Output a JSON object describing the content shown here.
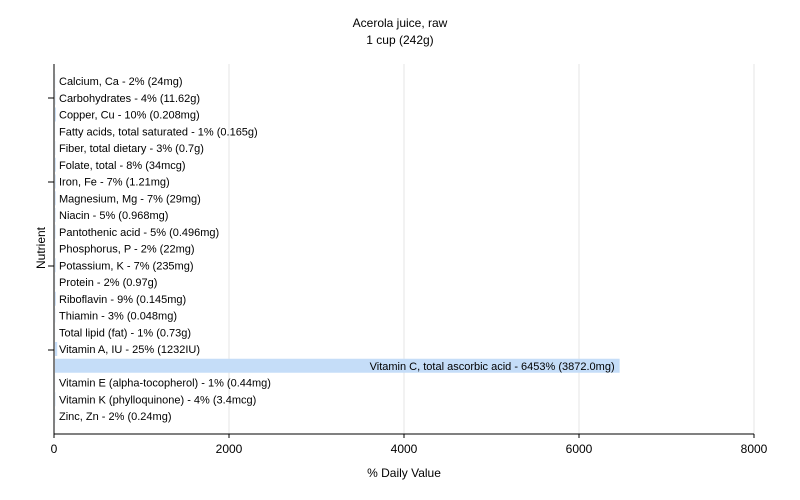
{
  "chart_data": {
    "type": "bar",
    "orientation": "horizontal",
    "title": "Acerola juice, raw",
    "subtitle": "1 cup (242g)",
    "xlabel": "% Daily Value",
    "ylabel": "Nutrient",
    "xlim": [
      0,
      8000
    ],
    "xticks": [
      0,
      2000,
      4000,
      6000,
      8000
    ],
    "grid": true,
    "bar_color": "#c5ddf8",
    "categories": [
      "Calcium, Ca",
      "Carbohydrates",
      "Copper, Cu",
      "Fatty acids, total saturated",
      "Fiber, total dietary",
      "Folate, total",
      "Iron, Fe",
      "Magnesium, Mg",
      "Niacin",
      "Pantothenic acid",
      "Phosphorus, P",
      "Potassium, K",
      "Protein",
      "Riboflavin",
      "Thiamin",
      "Total lipid (fat)",
      "Vitamin A, IU",
      "Vitamin C, total ascorbic acid",
      "Vitamin E (alpha-tocopherol)",
      "Vitamin K (phylloquinone)",
      "Zinc, Zn"
    ],
    "values": [
      2,
      4,
      10,
      1,
      3,
      8,
      7,
      7,
      5,
      5,
      2,
      7,
      2,
      9,
      3,
      1,
      25,
      6453,
      1,
      4,
      2
    ],
    "labels": [
      "Calcium, Ca - 2% (24mg)",
      "Carbohydrates - 4% (11.62g)",
      "Copper, Cu - 10% (0.208mg)",
      "Fatty acids, total saturated - 1% (0.165g)",
      "Fiber, total dietary - 3% (0.7g)",
      "Folate, total - 8% (34mcg)",
      "Iron, Fe - 7% (1.21mg)",
      "Magnesium, Mg - 7% (29mg)",
      "Niacin - 5% (0.968mg)",
      "Pantothenic acid - 5% (0.496mg)",
      "Phosphorus, P - 2% (22mg)",
      "Potassium, K - 7% (235mg)",
      "Protein - 2% (0.97g)",
      "Riboflavin - 9% (0.145mg)",
      "Thiamin - 3% (0.048mg)",
      "Total lipid (fat) - 1% (0.73g)",
      "Vitamin A, IU - 25% (1232IU)",
      "Vitamin C, total ascorbic acid - 6453% (3872.0mg)",
      "Vitamin E (alpha-tocopherol) - 1% (0.44mg)",
      "Vitamin K (phylloquinone) - 4% (3.4mcg)",
      "Zinc, Zn - 2% (0.24mg)"
    ]
  }
}
